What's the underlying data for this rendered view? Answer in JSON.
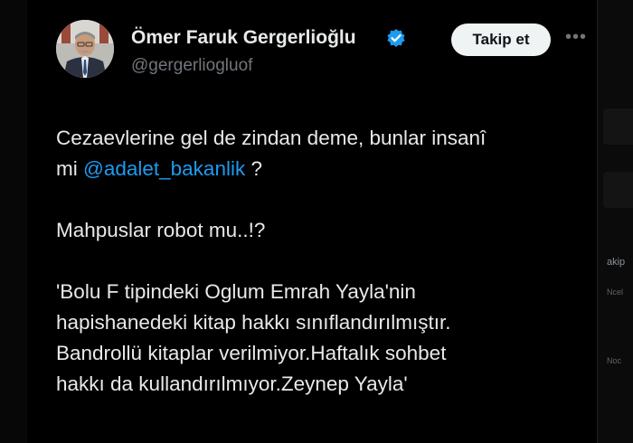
{
  "tweet": {
    "author": {
      "name": "Ömer Faruk Gergerlioğlu",
      "handle": "@gergerliogluof",
      "avatar_icon": "profile-photo"
    },
    "follow_label": "Takip et",
    "more_icon": "more-horizontal-icon",
    "body": {
      "line1": "Cezaevlerine gel de zindan deme, bunlar insanî",
      "line2_prefix": "mi ",
      "mention": "@adalet_bakanlik",
      "line2_suffix": " ?",
      "line3": "Mahpuslar robot mu..!?",
      "line4": "'Bolu F tipindeki Oglum Emrah Yayla'nin",
      "line5": "hapishanedeki  kitap hakkı sınıflandırılmıştır.",
      "line6": "Bandrollü kitaplar verilmiyor.Haftalık sohbet",
      "line7": "hakkı da kullandırılmıyor.Zeynep Yayla'"
    }
  },
  "right_panel": {
    "snippets": [
      "akip",
      "Ncel",
      "Noc"
    ]
  },
  "colors": {
    "background": "#000000",
    "text": "#e7e9ea",
    "secondary": "#71767b",
    "accent": "#1d9bf0"
  }
}
